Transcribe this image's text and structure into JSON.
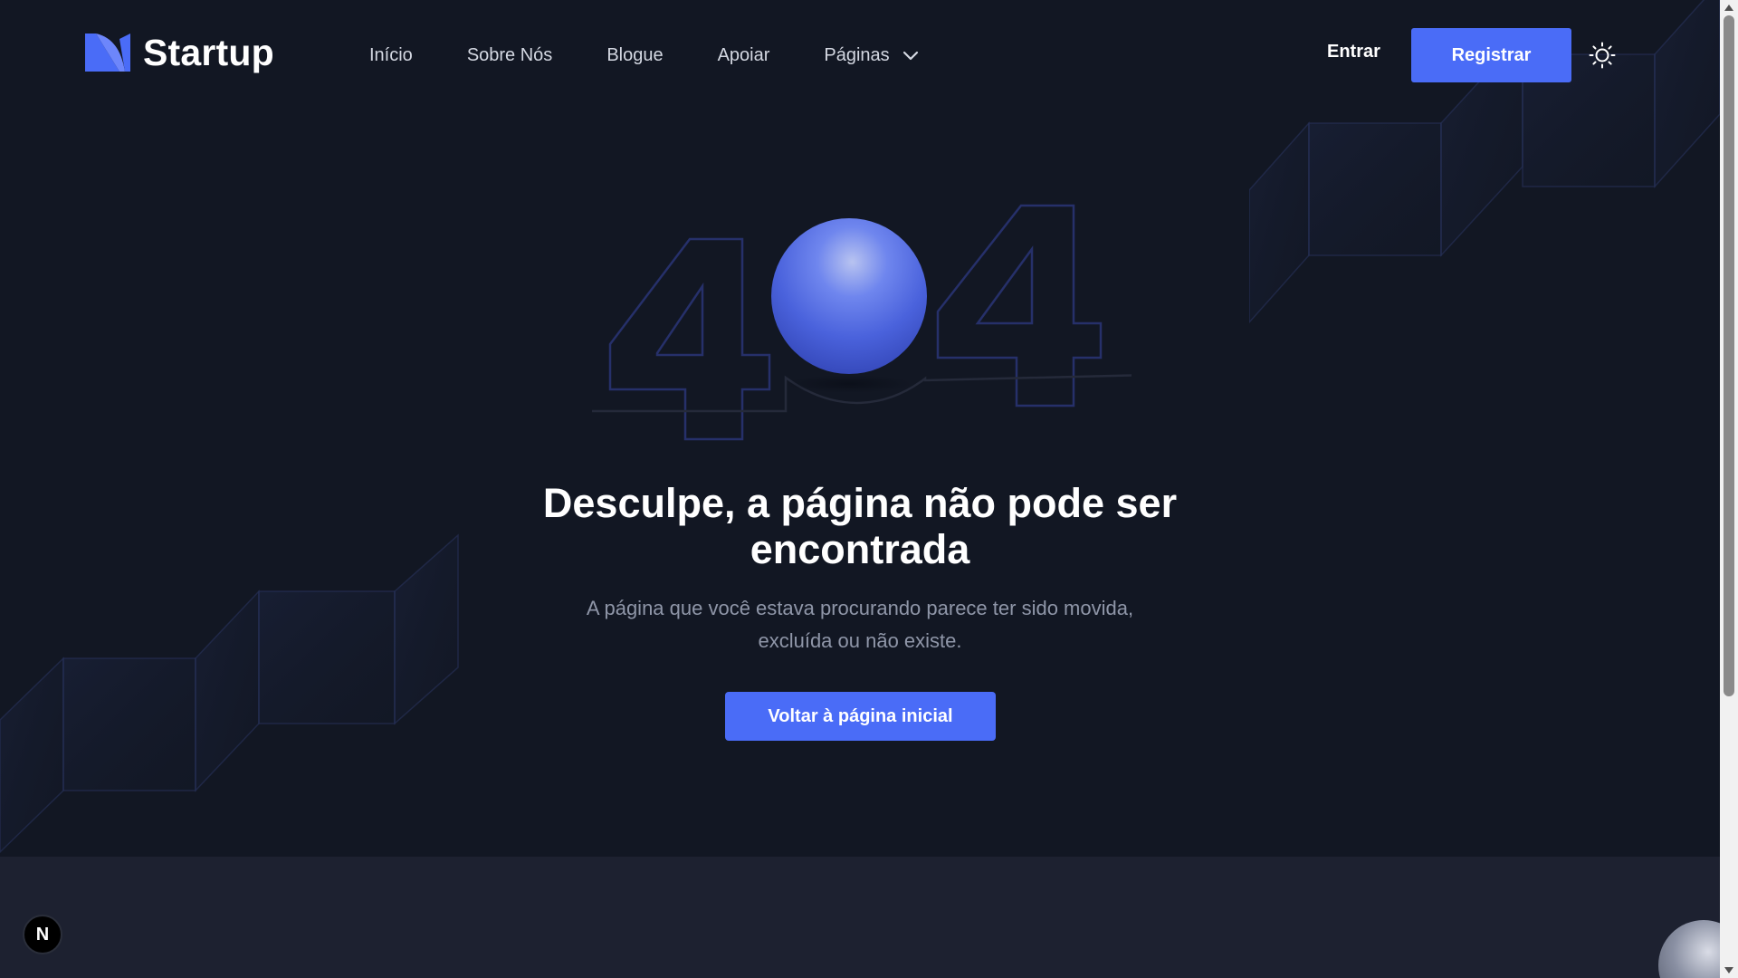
{
  "header": {
    "brand": "Startup",
    "nav": [
      {
        "label": "Início"
      },
      {
        "label": "Sobre Nós"
      },
      {
        "label": "Blogue"
      },
      {
        "label": "Apoiar"
      },
      {
        "label": "Páginas",
        "has_dropdown": true
      }
    ],
    "signin_label": "Entrar",
    "signup_label": "Registrar",
    "theme_icon": "sun-icon"
  },
  "error": {
    "code_graphic": "404",
    "title": "Desculpe, a página não pode ser encontrada",
    "subtitle": "A página que você estava procurando parece ter sido movida, excluída ou não existe.",
    "home_button": "Voltar à página inicial"
  },
  "dev_badge": {
    "label": "N"
  },
  "colors": {
    "background": "#121723",
    "footer_band": "#1d2130",
    "accent": "#4a6cf7",
    "text_primary": "#ffffff",
    "text_muted": "#8f96a8",
    "nav_text": "#d4d8e2"
  }
}
